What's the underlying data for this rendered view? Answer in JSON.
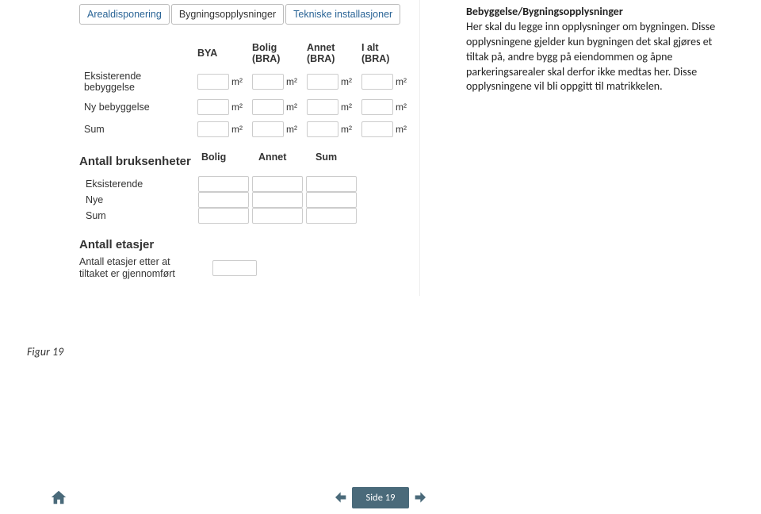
{
  "tabs": [
    "Arealdisponering",
    "Bygningsopplysninger",
    "Tekniske installasjoner"
  ],
  "areal": {
    "headers": [
      "",
      "BYA",
      "Bolig (BRA)",
      "Annet (BRA)",
      "I alt (BRA)"
    ],
    "rows": [
      {
        "label": "Eksisterende bebyggelse",
        "unit": "m²",
        "cells": [
          true,
          true,
          true,
          true
        ]
      },
      {
        "label": "Ny bebyggelse",
        "unit": "m²",
        "cells": [
          true,
          true,
          true,
          true
        ]
      },
      {
        "label": "Sum",
        "unit": "m²",
        "cells": [
          true,
          true,
          true,
          true
        ]
      }
    ]
  },
  "bruksenheter": {
    "title": "Antall bruksenheter",
    "headers": [
      "Bolig",
      "Annet",
      "Sum"
    ],
    "rows": [
      "Eksisterende",
      "Nye",
      "Sum"
    ]
  },
  "etasjer": {
    "title": "Antall etasjer",
    "label": "Antall etasjer etter at tiltaket er gjennomført"
  },
  "right": {
    "title": "Bebyggelse/Bygningsopplysninger",
    "body": "Her skal du legge inn opplysninger om bygningen. Disse opplysningene gjelder kun bygningen det skal gjøres et tiltak på, andre bygg på eiendommen og åpne parkeringsarealer skal derfor ikke medtas her. Disse opplysningene vil bli oppgitt til matrikkelen."
  },
  "figure": "Figur 19",
  "page": "Side 19"
}
